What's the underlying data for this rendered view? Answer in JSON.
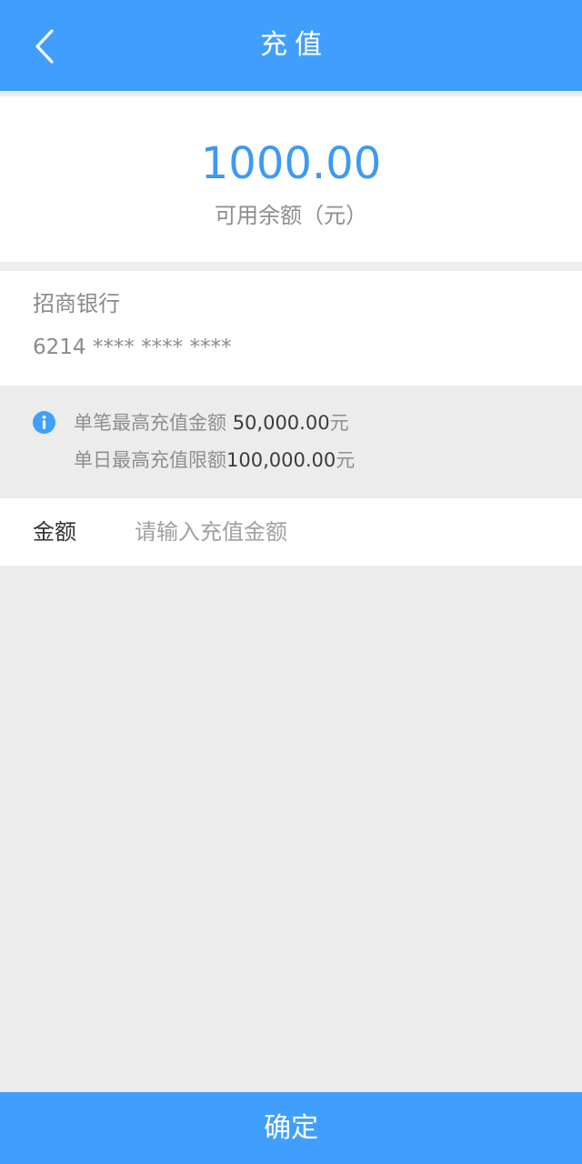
{
  "header": {
    "title": "充值",
    "back_icon": "chevron-left-icon"
  },
  "balance": {
    "amount": "1000.00",
    "label": "可用余额（元）"
  },
  "bank": {
    "name": "招商银行",
    "card_number": "6214 **** **** ****"
  },
  "limits": {
    "icon": "info-icon",
    "single_label": "单笔最高充值金额 ",
    "single_value": "50,000.00",
    "single_unit": "元",
    "daily_label": "单日最高充值限额",
    "daily_value": "100,000.00",
    "daily_unit": "元"
  },
  "amount_field": {
    "label": "金额",
    "value": "",
    "placeholder": "请输入充值金额"
  },
  "confirm_button": {
    "label": "确定"
  },
  "colors": {
    "primary": "#409ffc",
    "balance_text": "#3d9af2",
    "background": "#ededed"
  }
}
